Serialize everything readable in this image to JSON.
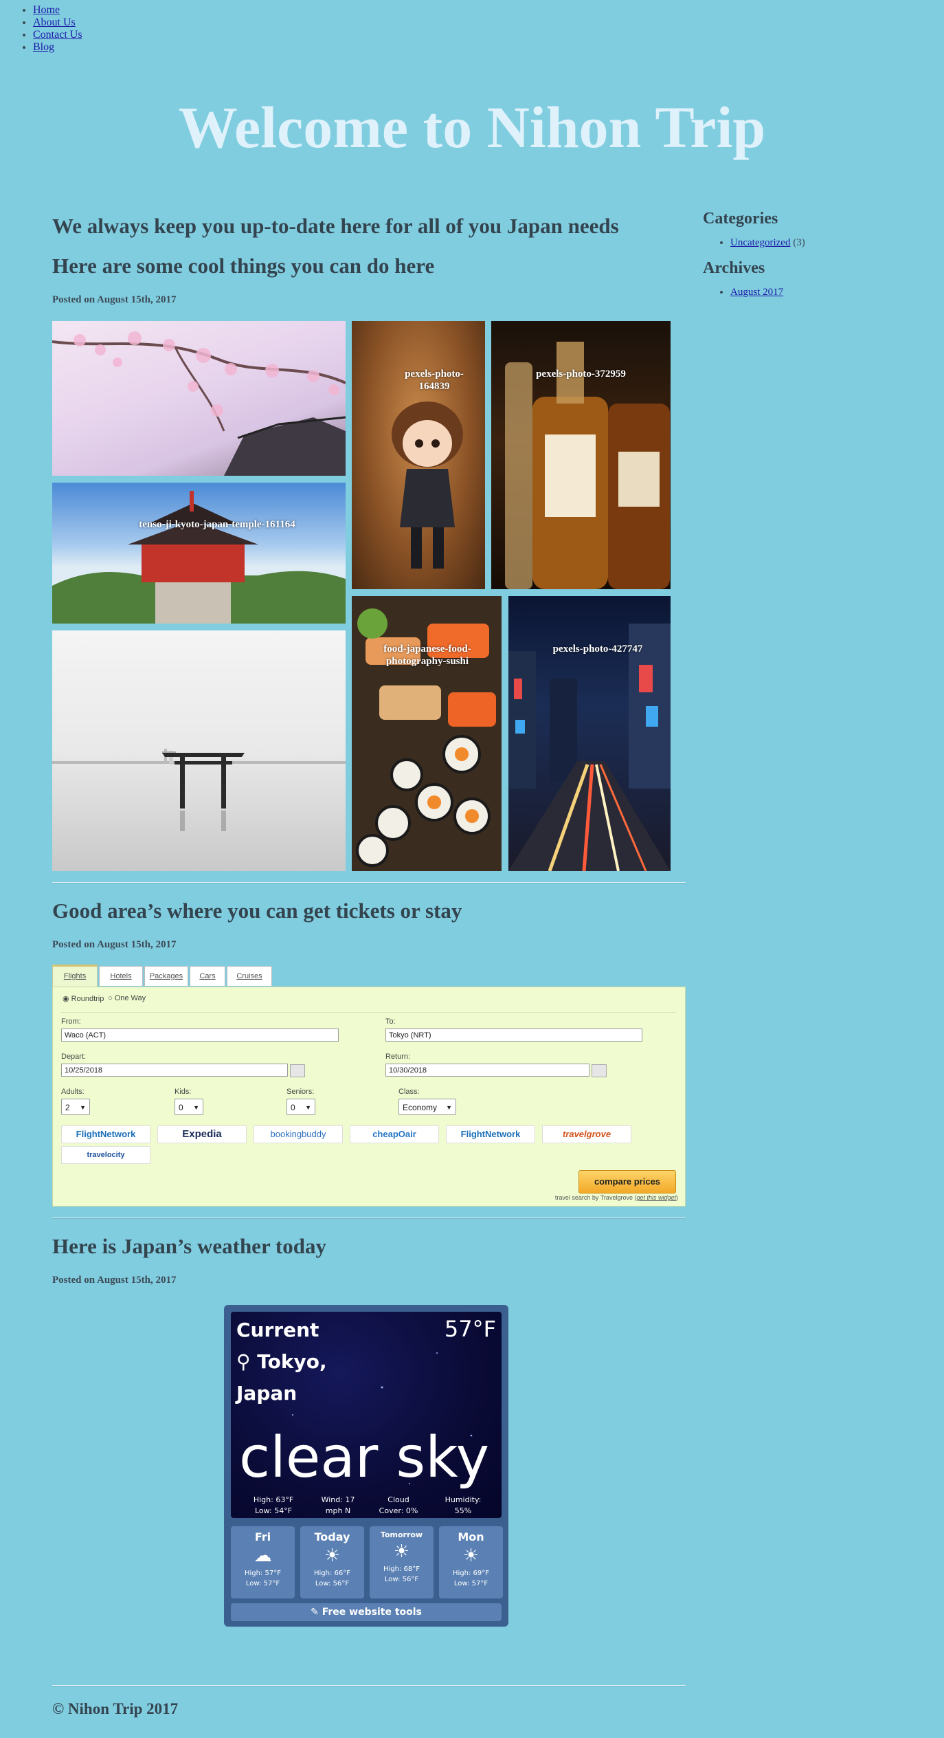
{
  "nav": [
    "Home",
    "About Us",
    "Contact Us",
    "Blog"
  ],
  "site_title": "Welcome to Nihon Trip",
  "posts": [
    {
      "title": "We always keep you up-to-date here for all of you Japan needs"
    },
    {
      "title": "Here are some cool things you can do here",
      "posted": "Posted on August 15th, 2017",
      "gallery": [
        "pexels-photo-164839",
        "pexels-photo-372959",
        "tenso-ji-kyoto-japan-temple-161164",
        "food-japanese-food-photography-sushi",
        "pexels-photo-427747"
      ]
    },
    {
      "title": "Good area’s where you can get tickets or stay",
      "posted": "Posted on August 15th, 2017"
    },
    {
      "title": "Here is Japan’s weather today",
      "posted": "Posted on August 15th, 2017"
    }
  ],
  "sidebar": {
    "categories_title": "Categories",
    "categories": [
      {
        "label": "Uncategorized",
        "count": "(3)"
      }
    ],
    "archives_title": "Archives",
    "archives": [
      "August 2017"
    ]
  },
  "travel": {
    "tabs": [
      "Flights",
      "Hotels",
      "Packages",
      "Cars",
      "Cruises"
    ],
    "trip_types": [
      "Roundtrip",
      "One Way"
    ],
    "from_label": "From:",
    "from_value": "Waco (ACT)",
    "to_label": "To:",
    "to_value": "Tokyo (NRT)",
    "depart_label": "Depart:",
    "depart_value": "10/25/2018",
    "return_label": "Return:",
    "return_value": "10/30/2018",
    "adults_label": "Adults:",
    "adults_value": "2",
    "kids_label": "Kids:",
    "kids_value": "0",
    "seniors_label": "Seniors:",
    "seniors_value": "0",
    "class_label": "Class:",
    "class_value": "Economy",
    "providers": [
      "FlightNetwork",
      "Expedia",
      "bookingbuddy",
      "cheapOair",
      "FlightNetwork",
      "travelgrove",
      "travelocity"
    ],
    "compare_label": "compare prices",
    "credit": "travel search by Travelgrove (",
    "credit_link": "get this widget",
    "credit_end": ")",
    "colors": {
      "panel": "#f0fcd0",
      "button": "#f3a928"
    }
  },
  "weather": {
    "current_label": "Current",
    "temp": "57°F",
    "city": "Tokyo,",
    "country": "Japan",
    "condition": "clear sky",
    "stats": [
      {
        "a": "High: 63°F",
        "b": "Low: 54°F"
      },
      {
        "a": "Wind: 17",
        "b": "mph N"
      },
      {
        "a": "Cloud",
        "b": "Cover: 0%"
      },
      {
        "a": "Humidity:",
        "b": "55%"
      }
    ],
    "forecast": [
      {
        "day": "Fri",
        "icon": "cloud-rain-icon",
        "high": "High: 57°F",
        "low": "Low: 57°F"
      },
      {
        "day": "Today",
        "icon": "sun-icon",
        "high": "High: 66°F",
        "low": "Low: 56°F"
      },
      {
        "day": "Tomorrow",
        "icon": "sun-icon",
        "high": "High: 68°F",
        "low": "Low: 56°F"
      },
      {
        "day": "Mon",
        "icon": "sun-icon",
        "high": "High: 69°F",
        "low": "Low: 57°F"
      }
    ],
    "footer": "Free website tools"
  },
  "footer": "© Nihon Trip 2017"
}
